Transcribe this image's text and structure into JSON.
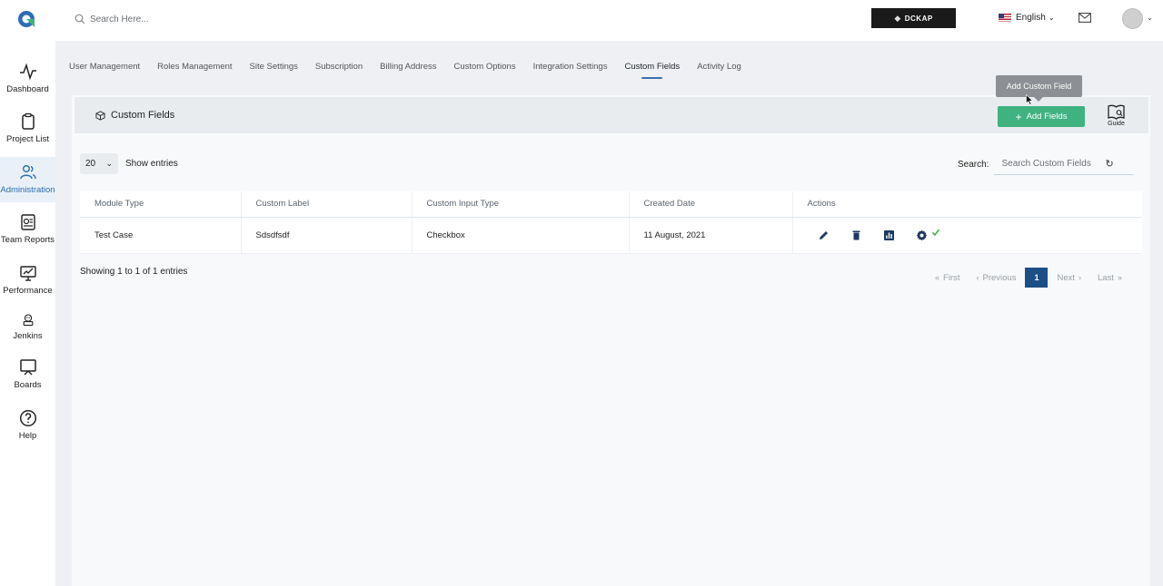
{
  "topbar": {
    "search_placeholder": "Search Here...",
    "brand": "DCKAP",
    "language": "English"
  },
  "sidebar": {
    "items": [
      {
        "label": "Dashboard",
        "icon": "activity-icon"
      },
      {
        "label": "Project List",
        "icon": "clipboard-icon"
      },
      {
        "label": "Administration",
        "icon": "users-icon",
        "active": true
      },
      {
        "label": "Team Reports",
        "icon": "report-icon"
      },
      {
        "label": "Performance",
        "icon": "performance-icon"
      },
      {
        "label": "Jenkins",
        "icon": "jenkins-icon"
      },
      {
        "label": "Boards",
        "icon": "board-icon"
      },
      {
        "label": "Help",
        "icon": "help-icon"
      }
    ]
  },
  "tabs": [
    {
      "label": "User Management"
    },
    {
      "label": "Roles Management"
    },
    {
      "label": "Site Settings"
    },
    {
      "label": "Subscription"
    },
    {
      "label": "Billing Address"
    },
    {
      "label": "Custom Options"
    },
    {
      "label": "Integration Settings"
    },
    {
      "label": "Custom Fields",
      "active": true
    },
    {
      "label": "Activity Log"
    }
  ],
  "tooltip": "Add Custom Field",
  "card": {
    "title": "Custom Fields",
    "add_button": "Add Fields",
    "guide_label": "Guide"
  },
  "controls": {
    "entries_value": "20",
    "entries_label": "Show entries",
    "search_label": "Search:",
    "search_placeholder": "Search Custom Fields"
  },
  "table": {
    "headers": [
      "Module Type",
      "Custom Label",
      "Custom Input Type",
      "Created Date",
      "Actions"
    ],
    "rows": [
      {
        "module_type": "Test Case",
        "custom_label": "Sdsdfsdf",
        "input_type": "Checkbox",
        "created_date": "11 August, 2021"
      }
    ]
  },
  "footer": {
    "showing": "Showing 1 to 1 of 1 entries",
    "first": "First",
    "previous": "Previous",
    "page": "1",
    "next": "Next",
    "last": "Last"
  },
  "colors": {
    "accent_green": "#3fb27f",
    "pager_active": "#1c4f86",
    "active_nav": "#2b6db0",
    "check_green": "#4caf50"
  }
}
